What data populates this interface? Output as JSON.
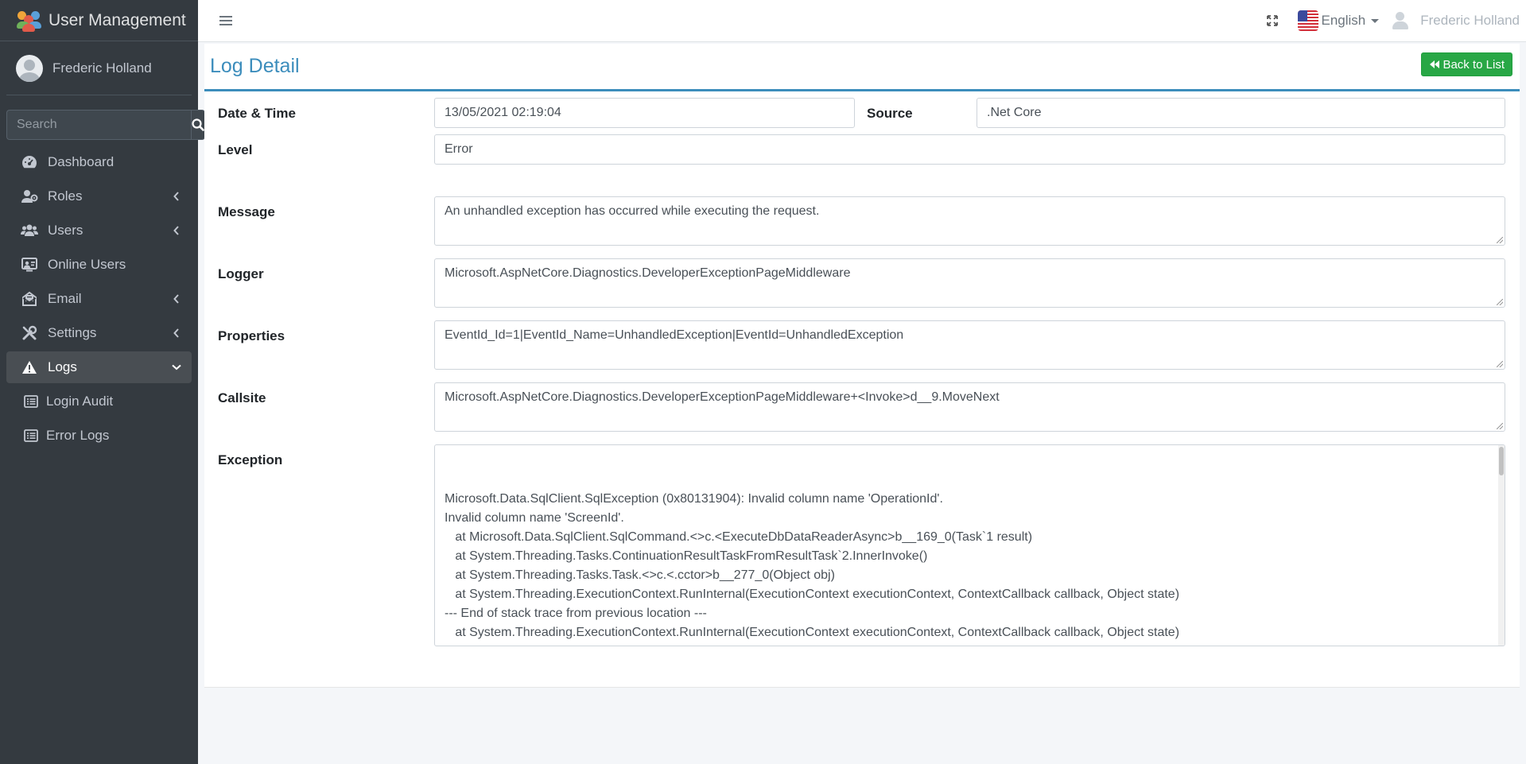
{
  "app": {
    "title": "User Management",
    "colors": {
      "sidebar_bg": "#343a40",
      "accent": "#3c8dbc",
      "success": "#28a745"
    }
  },
  "sidebar": {
    "user_name": "Frederic Holland",
    "search": {
      "placeholder": "Search"
    },
    "items": [
      {
        "label": "Dashboard",
        "icon": "dashboard-icon",
        "has_children": false,
        "active": false
      },
      {
        "label": "Roles",
        "icon": "roles-icon",
        "has_children": true,
        "active": false
      },
      {
        "label": "Users",
        "icon": "users-icon",
        "has_children": true,
        "active": false
      },
      {
        "label": "Online Users",
        "icon": "online-users-icon",
        "has_children": false,
        "active": false
      },
      {
        "label": "Email",
        "icon": "email-icon",
        "has_children": true,
        "active": false
      },
      {
        "label": "Settings",
        "icon": "settings-icon",
        "has_children": true,
        "active": false
      },
      {
        "label": "Logs",
        "icon": "warning-icon",
        "has_children": true,
        "active": true
      }
    ],
    "sub_items": [
      {
        "label": "Login Audit",
        "icon": "list-icon"
      },
      {
        "label": "Error Logs",
        "icon": "list-icon"
      }
    ]
  },
  "navbar": {
    "language": "English",
    "user_name": "Frederic Holland"
  },
  "page": {
    "title": "Log Detail",
    "back_button": "Back to List"
  },
  "log": {
    "datetime_label": "Date & Time",
    "datetime": "13/05/2021 02:19:04",
    "source_label": "Source",
    "source": ".Net Core",
    "level_label": "Level",
    "level": "Error",
    "message_label": "Message",
    "message": "An unhandled exception has occurred while executing the request.",
    "logger_label": "Logger",
    "logger": "Microsoft.AspNetCore.Diagnostics.DeveloperExceptionPageMiddleware",
    "properties_label": "Properties",
    "properties": "EventId_Id=1|EventId_Name=UnhandledException|EventId=UnhandledException",
    "callsite_label": "Callsite",
    "callsite": "Microsoft.AspNetCore.Diagnostics.DeveloperExceptionPageMiddleware+<Invoke>d__9.MoveNext",
    "exception_label": "Exception",
    "exception": "Microsoft.Data.SqlClient.SqlException (0x80131904): Invalid column name 'OperationId'.\nInvalid column name 'ScreenId'.\n   at Microsoft.Data.SqlClient.SqlCommand.<>c.<ExecuteDbDataReaderAsync>b__169_0(Task`1 result)\n   at System.Threading.Tasks.ContinuationResultTaskFromResultTask`2.InnerInvoke()\n   at System.Threading.Tasks.Task.<>c.<.cctor>b__277_0(Object obj)\n   at System.Threading.ExecutionContext.RunInternal(ExecutionContext executionContext, ContextCallback callback, Object state)\n--- End of stack trace from previous location ---\n   at System.Threading.ExecutionContext.RunInternal(ExecutionContext executionContext, ContextCallback callback, Object state)\n   at System.Threading.Tasks.Task.ExecuteWithThreadLocal(Task& currentTaskSlot, Thread threadPoolThread)\n--- End of stack trace from previous location ---"
  }
}
